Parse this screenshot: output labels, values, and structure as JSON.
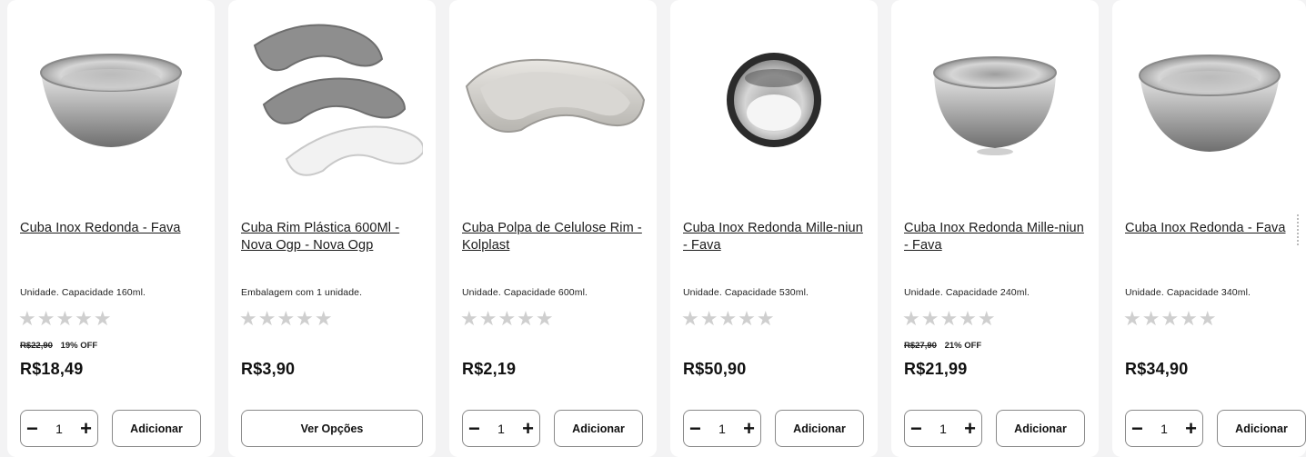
{
  "products": [
    {
      "name": "Cuba Inox Redonda - Fava",
      "description": "Unidade. Capacidade 160ml.",
      "rating": "★★★★★",
      "old_price": "R$22,90",
      "discount": "19% OFF",
      "price": "R$18,49",
      "quantity": "1",
      "action_label": "Adicionar",
      "image_icon": "steel-bowl-icon"
    },
    {
      "name": "Cuba Rim Plástica 600Ml - Nova Ogp - Nova Ogp",
      "description": "Embalagem com 1 unidade.",
      "rating": "★★★★★",
      "old_price": "",
      "discount": "",
      "price": "R$3,90",
      "quantity": "",
      "action_label": "Ver Opções",
      "image_icon": "kidney-dish-stack-icon"
    },
    {
      "name": "Cuba Polpa de Celulose Rim - Kolplast",
      "description": "Unidade. Capacidade 600ml.",
      "rating": "★★★★★",
      "old_price": "",
      "discount": "",
      "price": "R$2,19",
      "quantity": "1",
      "action_label": "Adicionar",
      "image_icon": "kidney-dish-icon"
    },
    {
      "name": "Cuba Inox Redonda Mille-niun - Fava",
      "description": "Unidade. Capacidade 530ml.",
      "rating": "★★★★★",
      "old_price": "",
      "discount": "",
      "price": "R$50,90",
      "quantity": "1",
      "action_label": "Adicionar",
      "image_icon": "steel-cup-icon"
    },
    {
      "name": "Cuba Inox Redonda Mille-niun - Fava",
      "description": "Unidade. Capacidade 240ml.",
      "rating": "★★★★★",
      "old_price": "R$27,90",
      "discount": "21% OFF",
      "price": "R$21,99",
      "quantity": "1",
      "action_label": "Adicionar",
      "image_icon": "steel-bowl-icon"
    },
    {
      "name": "Cuba Inox Redonda - Fava",
      "description": "Unidade. Capacidade 340ml.",
      "rating": "★★★★★",
      "old_price": "",
      "discount": "",
      "price": "R$34,90",
      "quantity": "1",
      "action_label": "Adicionar",
      "image_icon": "steel-bowl-icon"
    }
  ],
  "qty_minus": "−",
  "qty_plus": "+",
  "colors": {
    "background": "#f3f3f4",
    "card": "#ffffff",
    "star": "#cfcfcf",
    "border": "#8a8a8a"
  }
}
